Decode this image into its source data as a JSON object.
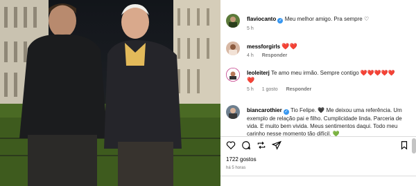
{
  "comments": [
    {
      "username": "flaviocanto",
      "verified": true,
      "text": "Meu melhor amigo. Pra sempre ♡",
      "time": "5 h",
      "likes": "",
      "reply": ""
    },
    {
      "username": "messforgirls",
      "verified": false,
      "text": "❤️❤️",
      "time": "4 h",
      "likes": "",
      "reply": "Responder"
    },
    {
      "username": "leoleiterj",
      "verified": false,
      "text": "Te amo meu irmão. Sempre contigo ❤️❤️❤️❤️❤️",
      "text_2": "❤️",
      "time": "5 h",
      "likes": "1 gosto",
      "reply": "Responder"
    },
    {
      "username": "biancarothier",
      "verified": true,
      "text": "Tio Felipe. 🖤 Me deixou uma referência. Um exemplo de relação pai e filho. Cumplicidade linda. Parceria de vida. E muito bem vivida. Meus sentimentos daqui. Todo meu carinho nesse momento tão difícil. 💚"
    }
  ],
  "likes_count": "1722 gostos",
  "posted_ago": "há 5 horas",
  "icons": {
    "like": "heart-outline-icon",
    "comment": "comment-bubble-icon",
    "share": "share-repost-icon",
    "send": "paper-plane-icon",
    "save": "bookmark-icon"
  },
  "colors": {
    "verified": "#3897f0",
    "heart_red": "#ed1c2e",
    "heart_green": "#2ea84d",
    "meta_gray": "#737373"
  }
}
